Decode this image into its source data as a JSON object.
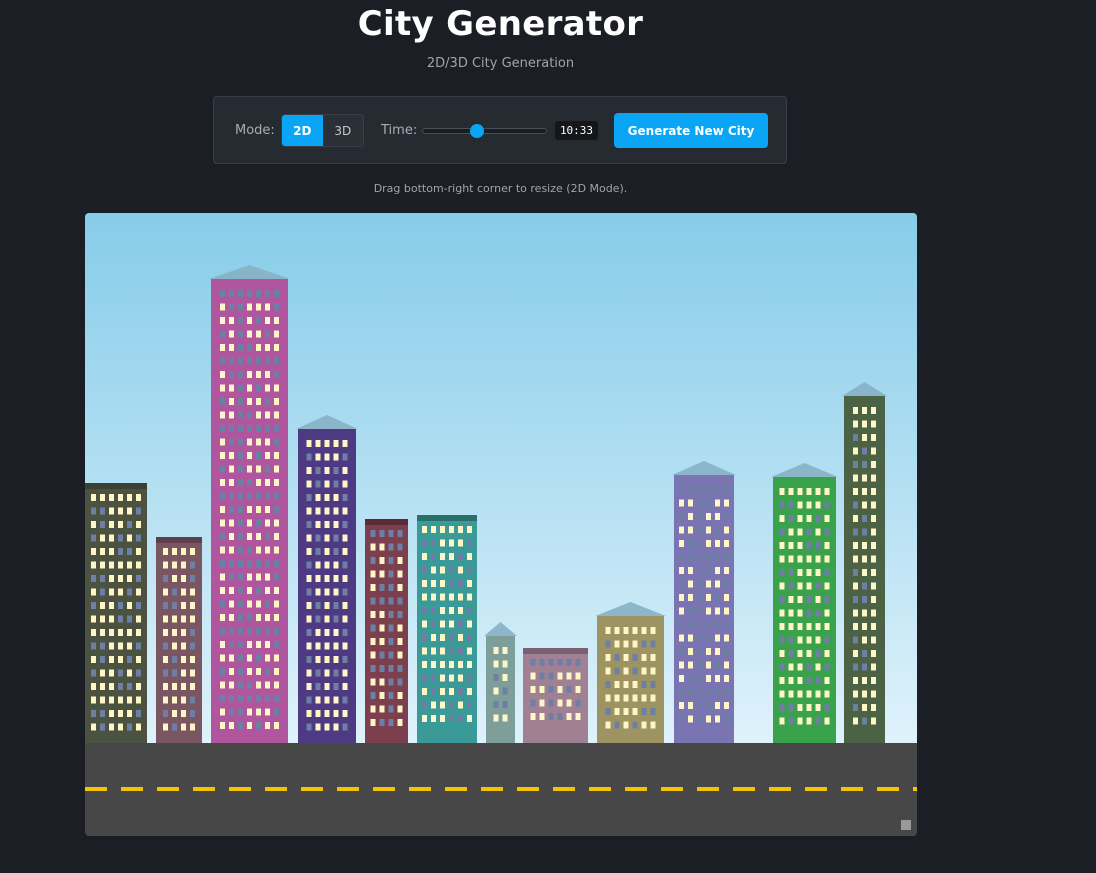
{
  "header": {
    "title": "City Generator",
    "subtitle": "2D/3D City Generation"
  },
  "controls": {
    "mode_label": "Mode:",
    "mode_options": [
      "2D",
      "3D"
    ],
    "mode_selected": "2D",
    "time_label": "Time:",
    "time_value": "10:33",
    "time_slider_fraction": 0.44,
    "generate_label": "Generate New City"
  },
  "hint": "Drag bottom-right corner to resize (2D Mode).",
  "colors": {
    "accent": "#0aa5f5",
    "background": "#1b1e24",
    "sky_top": "#86cce9",
    "sky_bottom": "#dff2fb",
    "road": "#474747",
    "road_line": "#f3c400",
    "roof": "#87b0c4",
    "window_lit": "#fff6c8",
    "window_dark": "#6e7fa6"
  },
  "city": {
    "buildings": [
      {
        "color": "#4b5240",
        "roof": "flat",
        "roof_color": "#3a4133"
      },
      {
        "color": "#7a5562",
        "roof": "flat",
        "roof_color": "#5f3f4b"
      },
      {
        "color": "#b0569e",
        "roof": "peak"
      },
      {
        "color": "#4e3a82",
        "roof": "peak"
      },
      {
        "color": "#7b3f4d",
        "roof": "flat",
        "roof_color": "#5c2b38"
      },
      {
        "color": "#3a9a97",
        "roof": "flat",
        "roof_color": "#2b6f6d"
      },
      {
        "color": "#7e9e9a",
        "roof": "peak"
      },
      {
        "color": "#a08194",
        "roof": "flat",
        "roof_color": "#7a6073"
      },
      {
        "color": "#9e9461",
        "roof": "peak"
      },
      {
        "color": "#7a74b3",
        "roof": "peak"
      },
      {
        "color": "#3aa24a",
        "roof": "peak"
      },
      {
        "color": "#4c6244",
        "roof": "peak"
      }
    ]
  }
}
